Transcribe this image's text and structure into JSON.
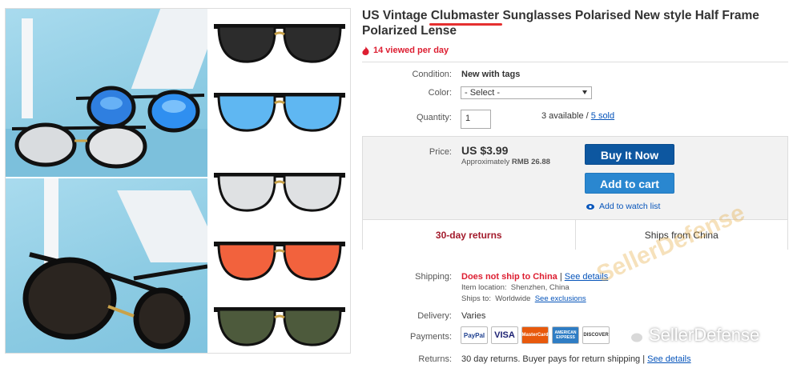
{
  "title": {
    "prefix": "US Vintage ",
    "highlight": "Clubmaster",
    "suffix": " Sunglasses Polarised New style Half Frame Polarized Lense"
  },
  "views": "14 viewed per day",
  "condition": {
    "label": "Condition:",
    "value": "New with tags"
  },
  "color": {
    "label": "Color:",
    "selected": "- Select -"
  },
  "quantity": {
    "label": "Quantity:",
    "value": "1",
    "available": "3 available / ",
    "sold": "5 sold"
  },
  "price": {
    "label": "Price:",
    "value": "US $3.99",
    "approx_label": "Approximately",
    "approx_value": "RMB 26.88"
  },
  "buttons": {
    "buy": "Buy It Now",
    "cart": "Add to cart",
    "watch": "Add to watch list"
  },
  "returns_cell": "30-day returns",
  "ships_cell": "Ships from China",
  "shipping": {
    "label": "Shipping:",
    "value": "Does not ship to China",
    "sep": " | ",
    "details": "See details",
    "location_label": "Item location:",
    "location": "Shenzhen, China",
    "ships_to_label": "Ships to:",
    "ships_to": "Worldwide",
    "exclusions": "See exclusions"
  },
  "delivery": {
    "label": "Delivery:",
    "value": "Varies"
  },
  "payments": {
    "label": "Payments:",
    "cards": [
      "PayPal",
      "VISA",
      "MasterCard",
      "AMERICAN EXPRESS",
      "DISCOVER"
    ]
  },
  "returns": {
    "label": "Returns:",
    "value": "30 day returns. Buyer pays for return shipping | ",
    "details": "See details"
  },
  "watermark": "SellerDefense",
  "logo_text": "SellerDefense",
  "colors": {
    "accent_red": "#dd1e31",
    "buy_blue": "#0d57a0",
    "cart_blue": "#2a87d0",
    "link_blue": "#0654ba"
  },
  "lens_swatches": [
    "black",
    "blue-mirror",
    "silver-mirror",
    "orange-mirror",
    "green"
  ]
}
